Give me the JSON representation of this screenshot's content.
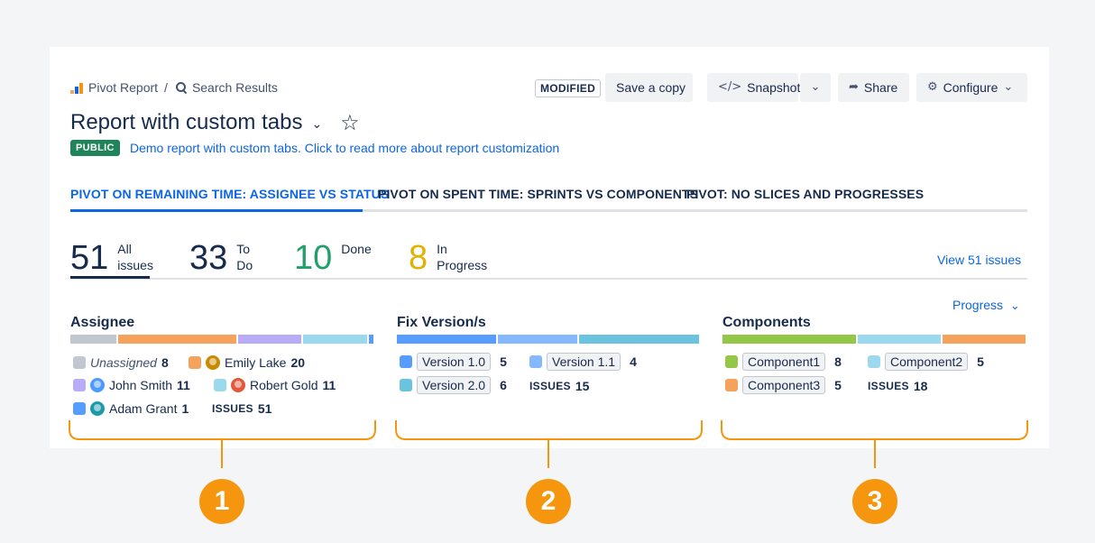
{
  "breadcrumb": {
    "report": "Pivot Report",
    "separator": "/",
    "search": "Search Results"
  },
  "toolbar": {
    "modified": "MODIFIED",
    "save_copy": "Save a copy",
    "snapshot": "Snapshot",
    "share": "Share",
    "configure": "Configure"
  },
  "header": {
    "title": "Report with custom tabs",
    "visibility": "PUBLIC",
    "description": "Demo report with custom tabs. Click to read more about report customization"
  },
  "tabs": [
    {
      "label": "PIVOT ON REMAINING TIME: ASSIGNEE VS STATUS",
      "active": true
    },
    {
      "label": "PIVOT ON SPENT TIME: SPRINTS VS COMPONENTS",
      "active": false
    },
    {
      "label": "PIVOT: NO SLICES AND PROGRESSES",
      "active": false
    }
  ],
  "stats": [
    {
      "value": "51",
      "label1": "All",
      "label2": "issues",
      "color": "#172b4d"
    },
    {
      "value": "33",
      "label1": "To",
      "label2": "Do",
      "color": "#172b4d"
    },
    {
      "value": "10",
      "label1": "Done",
      "label2": "",
      "color": "#22a06b"
    },
    {
      "value": "8",
      "label1": "In",
      "label2": "Progress",
      "color": "#e2b203"
    }
  ],
  "view_issues": "View 51 issues",
  "progress_dropdown": "Progress",
  "assignee": {
    "title": "Assignee",
    "segments": [
      {
        "value": 8,
        "color": "#c1c7d0"
      },
      {
        "value": 20,
        "color": "#f5a25d"
      },
      {
        "value": 11,
        "color": "#b8acf6"
      },
      {
        "value": 11,
        "color": "#9dd9ee"
      },
      {
        "value": 1,
        "color": "#579dff"
      }
    ],
    "items": [
      {
        "name": "Unassigned",
        "count": "8",
        "color": "#c1c7d0",
        "avatar": ""
      },
      {
        "name": "Emily Lake",
        "count": "20",
        "color": "#f5a25d",
        "avatar": "#c98a00"
      },
      {
        "name": "John Smith",
        "count": "11",
        "color": "#b8acf6",
        "avatar": "#4c9aff"
      },
      {
        "name": "Robert Gold",
        "count": "11",
        "color": "#9dd9ee",
        "avatar": "#e2583e"
      },
      {
        "name": "Adam Grant",
        "count": "1",
        "color": "#579dff",
        "avatar": "#1d9aaa"
      }
    ],
    "issues_label": "ISSUES",
    "issues_total": "51"
  },
  "fix_version": {
    "title": "Fix Version/s",
    "segments": [
      {
        "value": 5,
        "color": "#579dff"
      },
      {
        "value": 4,
        "color": "#85b8ff"
      },
      {
        "value": 6,
        "color": "#6cc3e0"
      }
    ],
    "items": [
      {
        "name": "Version 1.0",
        "count": "5",
        "color": "#579dff"
      },
      {
        "name": "Version 1.1",
        "count": "4",
        "color": "#85b8ff"
      },
      {
        "name": "Version 2.0",
        "count": "6",
        "color": "#6cc3e0"
      }
    ],
    "issues_label": "ISSUES",
    "issues_total": "15"
  },
  "components": {
    "title": "Components",
    "segments": [
      {
        "value": 8,
        "color": "#94c748"
      },
      {
        "value": 5,
        "color": "#9dd9ee"
      },
      {
        "value": 5,
        "color": "#f5a25d"
      }
    ],
    "items": [
      {
        "name": "Component1",
        "count": "8",
        "color": "#94c748"
      },
      {
        "name": "Component2",
        "count": "5",
        "color": "#9dd9ee"
      },
      {
        "name": "Component3",
        "count": "5",
        "color": "#f5a25d"
      }
    ],
    "issues_label": "ISSUES",
    "issues_total": "18"
  },
  "markers": [
    "1",
    "2",
    "3"
  ],
  "colors": {
    "accent": "#0c66e4",
    "marker": "#f5960e",
    "public": "#1f845a"
  }
}
